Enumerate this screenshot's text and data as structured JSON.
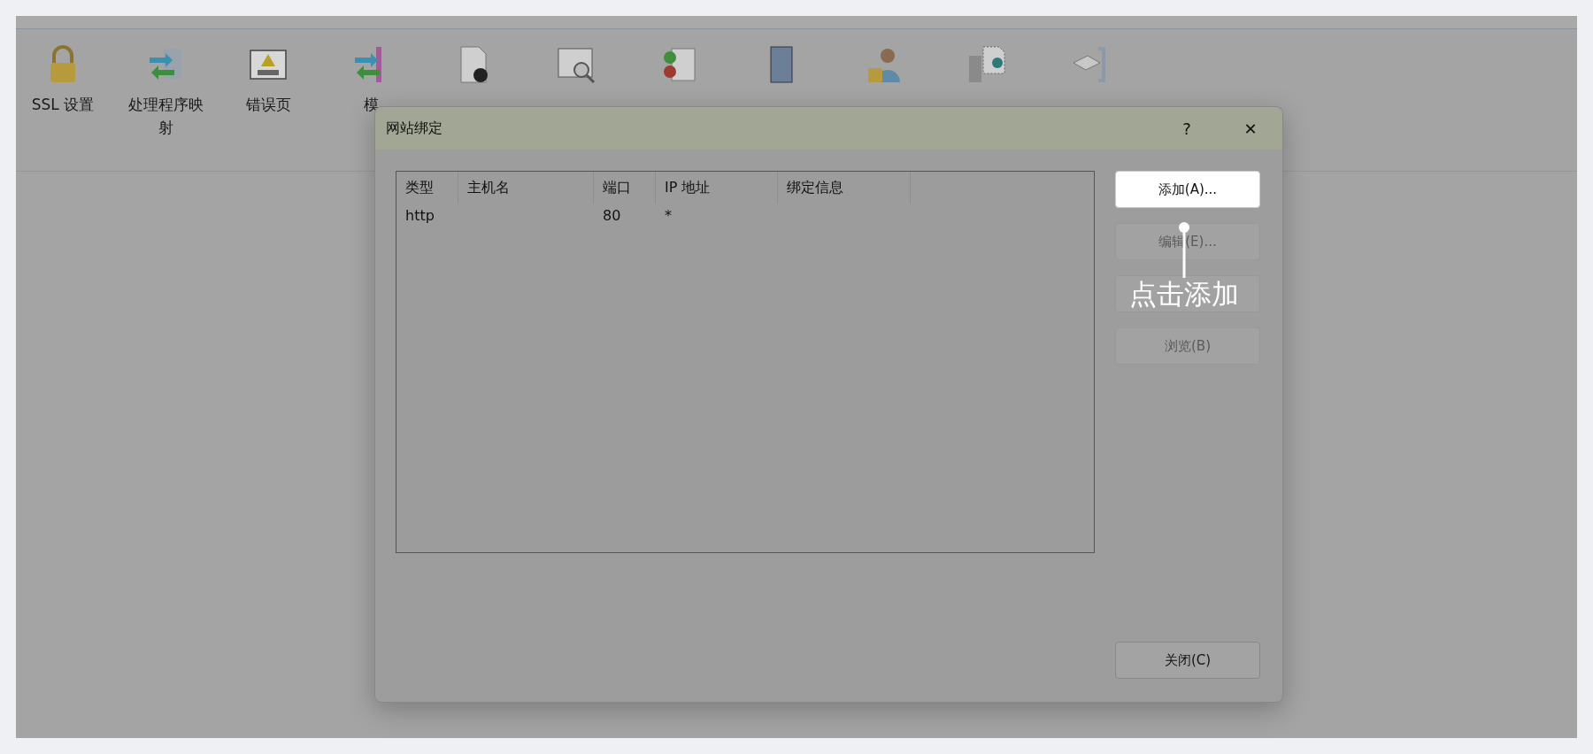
{
  "toolbar": [
    {
      "kind": "lock",
      "label": "SSL 设置"
    },
    {
      "kind": "mapping",
      "label": "处理程序映射"
    },
    {
      "kind": "error",
      "label": "错误页"
    },
    {
      "kind": "modules",
      "label": "模"
    },
    {
      "kind": "document"
    },
    {
      "kind": "browse"
    },
    {
      "kind": "filter"
    },
    {
      "kind": "log"
    },
    {
      "kind": "auth"
    },
    {
      "kind": "cache"
    },
    {
      "kind": "compress"
    }
  ],
  "dialog": {
    "title": "网站绑定",
    "help": "?",
    "close": "✕",
    "table": {
      "columns": [
        "类型",
        "主机名",
        "端口",
        "IP 地址",
        "绑定信息"
      ],
      "rows": [
        [
          "http",
          "",
          "80",
          "*",
          ""
        ]
      ]
    },
    "buttons": [
      {
        "label": "添加(A)...",
        "disabled": false
      },
      {
        "label": "编辑(E)...",
        "disabled": true
      },
      {
        "disabled": true
      },
      {
        "label": "浏览(B)",
        "disabled": true
      }
    ],
    "close_button": "关闭(C)"
  },
  "callout": {
    "text": "点击添加"
  }
}
